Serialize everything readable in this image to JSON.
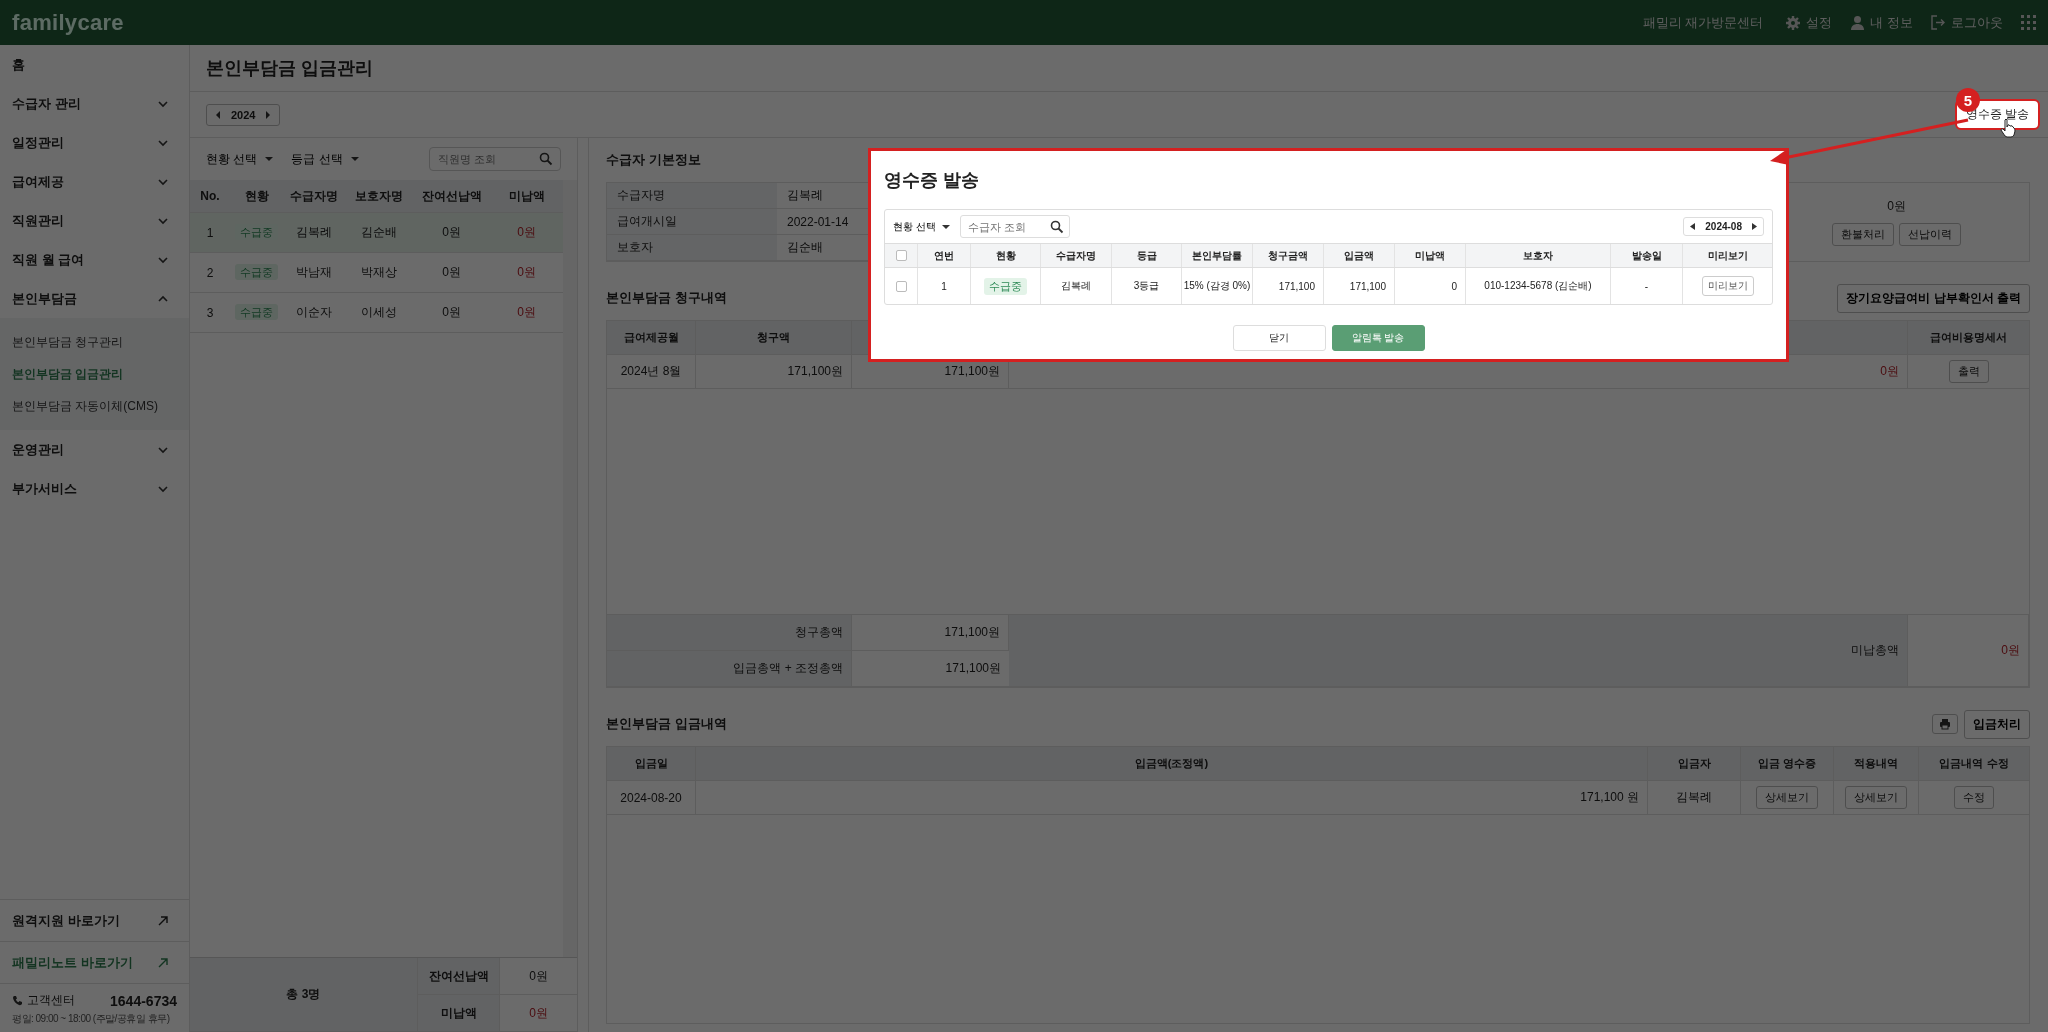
{
  "app": {
    "logo": "familycare",
    "center": "패밀리 재가방문센터",
    "nav": [
      {
        "kind": "settings",
        "label": "설정"
      },
      {
        "kind": "user",
        "label": "내 정보"
      },
      {
        "kind": "logout",
        "label": "로그아웃"
      }
    ]
  },
  "sidebar": {
    "items": [
      {
        "kind": "link",
        "label": "홈"
      },
      {
        "kind": "group",
        "label": "수급자 관리",
        "expanded": false
      },
      {
        "kind": "group",
        "label": "일정관리",
        "expanded": false
      },
      {
        "kind": "group",
        "label": "급여제공",
        "expanded": false
      },
      {
        "kind": "group",
        "label": "직원관리",
        "expanded": false
      },
      {
        "kind": "group",
        "label": "직원 월 급여",
        "expanded": false
      },
      {
        "kind": "group",
        "label": "본인부담금",
        "expanded": true,
        "children": [
          {
            "label": "본인부담금 청구관리",
            "selected": false
          },
          {
            "label": "본인부담금 입금관리",
            "selected": true
          },
          {
            "label": "본인부담금 자동이체(CMS)",
            "selected": false
          }
        ]
      },
      {
        "kind": "group",
        "label": "운영관리",
        "expanded": false
      },
      {
        "kind": "group",
        "label": "부가서비스",
        "expanded": false
      }
    ],
    "links": [
      {
        "kind": "default",
        "label": "원격지원 바로가기"
      },
      {
        "kind": "brand",
        "label": "패밀리노트 바로가기"
      }
    ],
    "contact": {
      "label": "고객센터",
      "phone": "1644-6734",
      "hours": "평일: 09:00 ~ 18:00 (주말/공휴일 휴무)"
    }
  },
  "page": {
    "title": "본인부담금 입금관리",
    "year": "2024",
    "receipt_button": "영수증 발송"
  },
  "list": {
    "filters": [
      "현황 선택",
      "등급 선택"
    ],
    "search": {
      "placeholder": "직원명 조회"
    },
    "columns": [
      "No.",
      "현황",
      "수급자명",
      "보호자명",
      "잔여선납액",
      "미납액"
    ],
    "rows": [
      {
        "no": "1",
        "status": "수급중",
        "name": "김복례",
        "guardian": "김순배",
        "prepaid": "0원",
        "unpaid": "0원",
        "selected": true
      },
      {
        "no": "2",
        "status": "수급중",
        "name": "박남재",
        "guardian": "박재상",
        "prepaid": "0원",
        "unpaid": "0원",
        "selected": false
      },
      {
        "no": "3",
        "status": "수급중",
        "name": "이순자",
        "guardian": "이세성",
        "prepaid": "0원",
        "unpaid": "0원",
        "selected": false
      }
    ],
    "summary": {
      "total": "총 3명",
      "rows": [
        {
          "label": "잔여선납액",
          "value": "0원"
        },
        {
          "label": "미납액",
          "value": "0원"
        }
      ]
    }
  },
  "basic_info": {
    "title": "수급자 기본정보",
    "fields": [
      {
        "label": "수급자명",
        "value": "김복례"
      },
      {
        "label": "급여개시일",
        "value": "2022-01-14"
      },
      {
        "label": "보호자",
        "value": "김순배"
      }
    ],
    "amount": "0원",
    "buttons": [
      "환불처리",
      "선납이력"
    ]
  },
  "billing": {
    "title": "본인부담금 청구내역",
    "action": "장기요양급여비 납부확인서 출력",
    "columns": [
      "급여제공월",
      "청구액"
    ],
    "last_column": "급여비용명세서",
    "rows": [
      {
        "month": "2024년 8월",
        "billed": "171,100원",
        "paid": "171,100원",
        "unpaid": "0원",
        "action": "출력"
      }
    ],
    "totals": [
      {
        "label": "청구총액",
        "value": "171,100원"
      },
      {
        "label": "입금총액 + 조정총액",
        "value": "171,100원"
      }
    ],
    "unpaid_total": {
      "label": "미납총액",
      "value": "0원"
    }
  },
  "deposits": {
    "title": "본인부담금 입금내역",
    "action": "입금처리",
    "columns": [
      "입금일",
      "입금액(조정액)",
      "입금자",
      "입금 영수증",
      "적용내역",
      "입금내역 수정"
    ],
    "rows": [
      {
        "date": "2024-08-20",
        "amount": "171,100 원",
        "payer": "김복례",
        "receipt": "상세보기",
        "applied": "상세보기",
        "edit": "수정"
      }
    ]
  },
  "modal": {
    "title": "영수증 발송",
    "filter": "현황 선택",
    "search": {
      "placeholder": "수급자 조회"
    },
    "month": "2024-08",
    "all_checked": false,
    "columns": [
      "연번",
      "현황",
      "수급자명",
      "등급",
      "본인부담률",
      "청구금액",
      "입금액",
      "미납액",
      "보호자",
      "발송일",
      "미리보기"
    ],
    "rows": [
      {
        "checked": false,
        "no": "1",
        "status": "수급중",
        "name": "김복례",
        "grade": "3등급",
        "rate": "15% (감경 0%)",
        "billed": "171,100",
        "paid": "171,100",
        "unpaid": "0",
        "guardian": "010-1234-5678 (김순배)",
        "sent": "-",
        "preview": "미리보기"
      }
    ],
    "buttons": {
      "close": "닫기",
      "send": "알림톡 발송"
    }
  },
  "annotation": {
    "step": "5"
  }
}
